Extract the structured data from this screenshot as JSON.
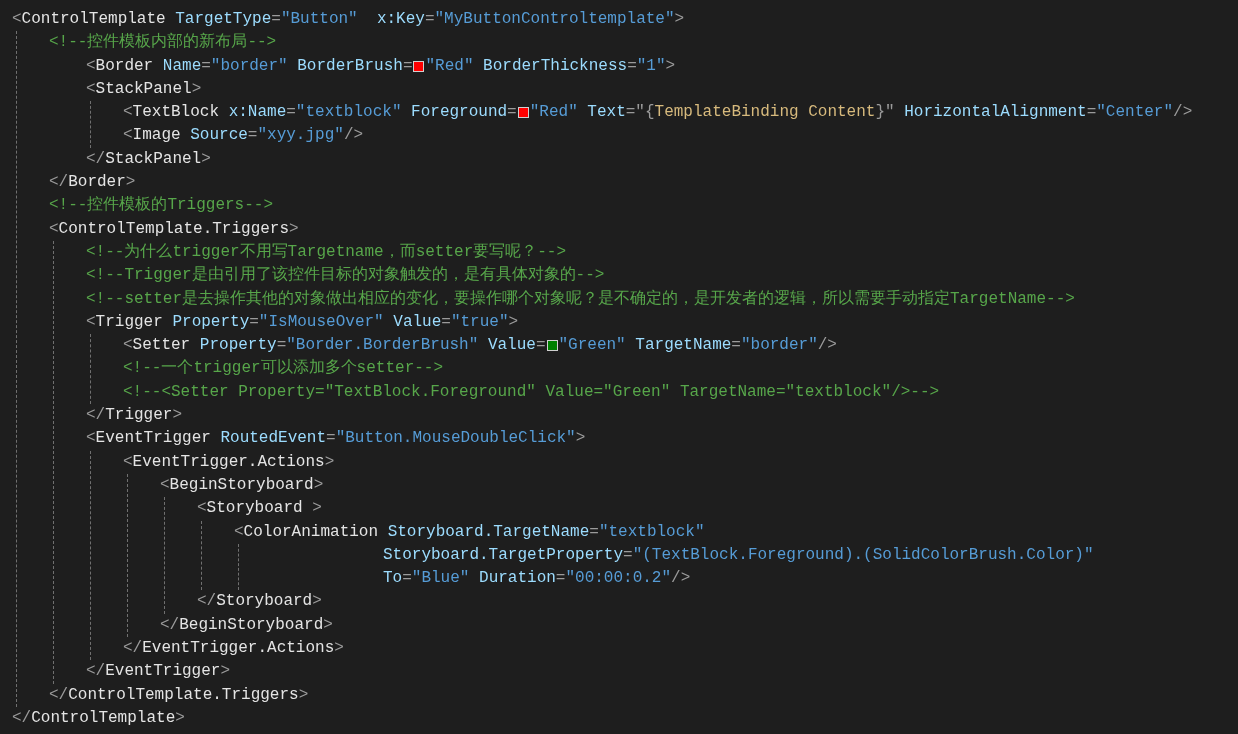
{
  "lines": [
    {
      "tokens": [
        {
          "kind": "punct",
          "text": "<"
        },
        {
          "kind": "element",
          "text": "ControlTemplate"
        },
        {
          "kind": "attr",
          "text": " TargetType"
        },
        {
          "kind": "punct",
          "text": "="
        },
        {
          "kind": "value",
          "text": "\"Button\""
        },
        {
          "kind": "attr",
          "text": "  x:Key"
        },
        {
          "kind": "punct",
          "text": "="
        },
        {
          "kind": "value",
          "text": "\"MyButtonControltemplate\""
        },
        {
          "kind": "punct",
          "text": ">"
        }
      ],
      "guide": true,
      "children": [
        {
          "tokens": [
            {
              "kind": "comment",
              "text": "<!--控件模板内部的新布局-->"
            }
          ],
          "children": [
            {
              "tokens": [
                {
                  "kind": "punct",
                  "text": "<"
                },
                {
                  "kind": "element",
                  "text": "Border"
                },
                {
                  "kind": "attr",
                  "text": " Name"
                },
                {
                  "kind": "punct",
                  "text": "="
                },
                {
                  "kind": "value",
                  "text": "\"border\""
                },
                {
                  "kind": "attr",
                  "text": " BorderBrush"
                },
                {
                  "kind": "punct",
                  "text": "="
                },
                {
                  "kind": "swatch",
                  "color": "#ff0000"
                },
                {
                  "kind": "value",
                  "text": "\"Red\""
                },
                {
                  "kind": "attr",
                  "text": " BorderThickness"
                },
                {
                  "kind": "punct",
                  "text": "="
                },
                {
                  "kind": "value",
                  "text": "\"1\""
                },
                {
                  "kind": "punct",
                  "text": ">"
                }
              ]
            },
            {
              "tokens": [
                {
                  "kind": "punct",
                  "text": "<"
                },
                {
                  "kind": "element",
                  "text": "StackPanel"
                },
                {
                  "kind": "punct",
                  "text": ">"
                }
              ],
              "guide": true,
              "children": [
                {
                  "tokens": [
                    {
                      "kind": "punct",
                      "text": "<"
                    },
                    {
                      "kind": "element",
                      "text": "TextBlock"
                    },
                    {
                      "kind": "attr",
                      "text": " x:Name"
                    },
                    {
                      "kind": "punct",
                      "text": "="
                    },
                    {
                      "kind": "value",
                      "text": "\"textblock\""
                    },
                    {
                      "kind": "attr",
                      "text": " Foreground"
                    },
                    {
                      "kind": "punct",
                      "text": "="
                    },
                    {
                      "kind": "swatch",
                      "color": "#ff0000"
                    },
                    {
                      "kind": "value",
                      "text": "\"Red\""
                    },
                    {
                      "kind": "attr",
                      "text": " Text"
                    },
                    {
                      "kind": "punct",
                      "text": "=\"{"
                    },
                    {
                      "kind": "binding",
                      "text": "TemplateBinding Content"
                    },
                    {
                      "kind": "punct",
                      "text": "}\""
                    },
                    {
                      "kind": "attr",
                      "text": " HorizontalAlignment"
                    },
                    {
                      "kind": "punct",
                      "text": "="
                    },
                    {
                      "kind": "value",
                      "text": "\"Center\""
                    },
                    {
                      "kind": "punct",
                      "text": "/>"
                    }
                  ]
                },
                {
                  "tokens": [
                    {
                      "kind": "punct",
                      "text": "<"
                    },
                    {
                      "kind": "element",
                      "text": "Image"
                    },
                    {
                      "kind": "attr",
                      "text": " Source"
                    },
                    {
                      "kind": "punct",
                      "text": "="
                    },
                    {
                      "kind": "value",
                      "text": "\"xyy.jpg\""
                    },
                    {
                      "kind": "punct",
                      "text": "/>"
                    }
                  ]
                }
              ]
            },
            {
              "tokens": [
                {
                  "kind": "punct",
                  "text": "</"
                },
                {
                  "kind": "element",
                  "text": "StackPanel"
                },
                {
                  "kind": "punct",
                  "text": ">"
                }
              ]
            }
          ]
        },
        {
          "tokens": [
            {
              "kind": "punct",
              "text": "</"
            },
            {
              "kind": "element",
              "text": "Border"
            },
            {
              "kind": "punct",
              "text": ">"
            }
          ]
        },
        {
          "tokens": [
            {
              "kind": "comment",
              "text": "<!--控件模板的Triggers-->"
            }
          ]
        },
        {
          "tokens": [
            {
              "kind": "punct",
              "text": "<"
            },
            {
              "kind": "element",
              "text": "ControlTemplate.Triggers"
            },
            {
              "kind": "punct",
              "text": ">"
            }
          ],
          "guide": true,
          "children": [
            {
              "tokens": [
                {
                  "kind": "comment",
                  "text": "<!--为什么trigger不用写Targetname，而setter要写呢？-->"
                }
              ]
            },
            {
              "tokens": [
                {
                  "kind": "comment",
                  "text": "<!--Trigger是由引用了该控件目标的对象触发的，是有具体对象的-->"
                }
              ]
            },
            {
              "tokens": [
                {
                  "kind": "comment",
                  "text": "<!--setter是去操作其他的对象做出相应的变化，要操作哪个对象呢？是不确定的，是开发者的逻辑，所以需要手动指定TargetName-->"
                }
              ]
            },
            {
              "tokens": [
                {
                  "kind": "punct",
                  "text": "<"
                },
                {
                  "kind": "element",
                  "text": "Trigger"
                },
                {
                  "kind": "attr",
                  "text": " Property"
                },
                {
                  "kind": "punct",
                  "text": "="
                },
                {
                  "kind": "value",
                  "text": "\"IsMouseOver\""
                },
                {
                  "kind": "attr",
                  "text": " Value"
                },
                {
                  "kind": "punct",
                  "text": "="
                },
                {
                  "kind": "value",
                  "text": "\"true\""
                },
                {
                  "kind": "punct",
                  "text": ">"
                }
              ],
              "guide": true,
              "children": [
                {
                  "tokens": [
                    {
                      "kind": "punct",
                      "text": "<"
                    },
                    {
                      "kind": "element",
                      "text": "Setter"
                    },
                    {
                      "kind": "attr",
                      "text": " Property"
                    },
                    {
                      "kind": "punct",
                      "text": "="
                    },
                    {
                      "kind": "value",
                      "text": "\"Border.BorderBrush\""
                    },
                    {
                      "kind": "attr",
                      "text": " Value"
                    },
                    {
                      "kind": "punct",
                      "text": "="
                    },
                    {
                      "kind": "swatch",
                      "color": "#008000"
                    },
                    {
                      "kind": "value",
                      "text": "\"Green\""
                    },
                    {
                      "kind": "attr",
                      "text": " TargetName"
                    },
                    {
                      "kind": "punct",
                      "text": "="
                    },
                    {
                      "kind": "value",
                      "text": "\"border\""
                    },
                    {
                      "kind": "punct",
                      "text": "/>"
                    }
                  ]
                },
                {
                  "tokens": [
                    {
                      "kind": "comment",
                      "text": "<!--一个trigger可以添加多个setter-->"
                    }
                  ]
                },
                {
                  "tokens": [
                    {
                      "kind": "comment",
                      "text": "<!--<Setter Property=\"TextBlock.Foreground\" Value=\"Green\" TargetName=\"textblock\"/>-->"
                    }
                  ]
                }
              ]
            },
            {
              "tokens": [
                {
                  "kind": "punct",
                  "text": "</"
                },
                {
                  "kind": "element",
                  "text": "Trigger"
                },
                {
                  "kind": "punct",
                  "text": ">"
                }
              ]
            },
            {
              "tokens": [
                {
                  "kind": "punct",
                  "text": "<"
                },
                {
                  "kind": "element",
                  "text": "EventTrigger"
                },
                {
                  "kind": "attr",
                  "text": " RoutedEvent"
                },
                {
                  "kind": "punct",
                  "text": "="
                },
                {
                  "kind": "value",
                  "text": "\"Button.MouseDoubleClick\""
                },
                {
                  "kind": "punct",
                  "text": ">"
                }
              ],
              "guide": true,
              "children": [
                {
                  "tokens": [
                    {
                      "kind": "punct",
                      "text": "<"
                    },
                    {
                      "kind": "element",
                      "text": "EventTrigger.Actions"
                    },
                    {
                      "kind": "punct",
                      "text": ">"
                    }
                  ],
                  "guide": true,
                  "children": [
                    {
                      "tokens": [
                        {
                          "kind": "punct",
                          "text": "<"
                        },
                        {
                          "kind": "element",
                          "text": "BeginStoryboard"
                        },
                        {
                          "kind": "punct",
                          "text": ">"
                        }
                      ],
                      "guide": true,
                      "children": [
                        {
                          "tokens": [
                            {
                              "kind": "punct",
                              "text": "<"
                            },
                            {
                              "kind": "element",
                              "text": "Storyboard"
                            },
                            {
                              "kind": "punct",
                              "text": " >"
                            }
                          ],
                          "guide": true,
                          "children": [
                            {
                              "tokens": [
                                {
                                  "kind": "punct",
                                  "text": "<"
                                },
                                {
                                  "kind": "element",
                                  "text": "ColorAnimation"
                                },
                                {
                                  "kind": "attr",
                                  "text": " Storyboard.TargetName"
                                },
                                {
                                  "kind": "punct",
                                  "text": "="
                                },
                                {
                                  "kind": "value",
                                  "text": "\"textblock\""
                                }
                              ],
                              "guide": true,
                              "children": [
                                {
                                  "kind": "continuation",
                                  "tokens": [
                                    {
                                      "kind": "attr",
                                      "text": "Storyboard.TargetProperty"
                                    },
                                    {
                                      "kind": "punct",
                                      "text": "="
                                    },
                                    {
                                      "kind": "value",
                                      "text": "\"(TextBlock.Foreground).(SolidColorBrush.Color)\""
                                    }
                                  ]
                                },
                                {
                                  "kind": "continuation",
                                  "tokens": [
                                    {
                                      "kind": "attr",
                                      "text": "To"
                                    },
                                    {
                                      "kind": "punct",
                                      "text": "="
                                    },
                                    {
                                      "kind": "value",
                                      "text": "\"Blue\""
                                    },
                                    {
                                      "kind": "attr",
                                      "text": " Duration"
                                    },
                                    {
                                      "kind": "punct",
                                      "text": "="
                                    },
                                    {
                                      "kind": "value",
                                      "text": "\"00:00:0.2\""
                                    },
                                    {
                                      "kind": "punct",
                                      "text": "/>"
                                    }
                                  ]
                                }
                              ]
                            }
                          ]
                        },
                        {
                          "tokens": [
                            {
                              "kind": "punct",
                              "text": "</"
                            },
                            {
                              "kind": "element",
                              "text": "Storyboard"
                            },
                            {
                              "kind": "punct",
                              "text": ">"
                            }
                          ]
                        }
                      ]
                    },
                    {
                      "tokens": [
                        {
                          "kind": "punct",
                          "text": "</"
                        },
                        {
                          "kind": "element",
                          "text": "BeginStoryboard"
                        },
                        {
                          "kind": "punct",
                          "text": ">"
                        }
                      ]
                    }
                  ]
                },
                {
                  "tokens": [
                    {
                      "kind": "punct",
                      "text": "</"
                    },
                    {
                      "kind": "element",
                      "text": "EventTrigger.Actions"
                    },
                    {
                      "kind": "punct",
                      "text": ">"
                    }
                  ]
                }
              ]
            },
            {
              "tokens": [
                {
                  "kind": "punct",
                  "text": "</"
                },
                {
                  "kind": "element",
                  "text": "EventTrigger"
                },
                {
                  "kind": "punct",
                  "text": ">"
                }
              ]
            }
          ]
        },
        {
          "tokens": [
            {
              "kind": "punct",
              "text": "</"
            },
            {
              "kind": "element",
              "text": "ControlTemplate.Triggers"
            },
            {
              "kind": "punct",
              "text": ">"
            }
          ]
        }
      ]
    },
    {
      "tokens": [
        {
          "kind": "punct",
          "text": "</"
        },
        {
          "kind": "element",
          "text": "ControlTemplate"
        },
        {
          "kind": "punct",
          "text": ">"
        }
      ]
    }
  ]
}
